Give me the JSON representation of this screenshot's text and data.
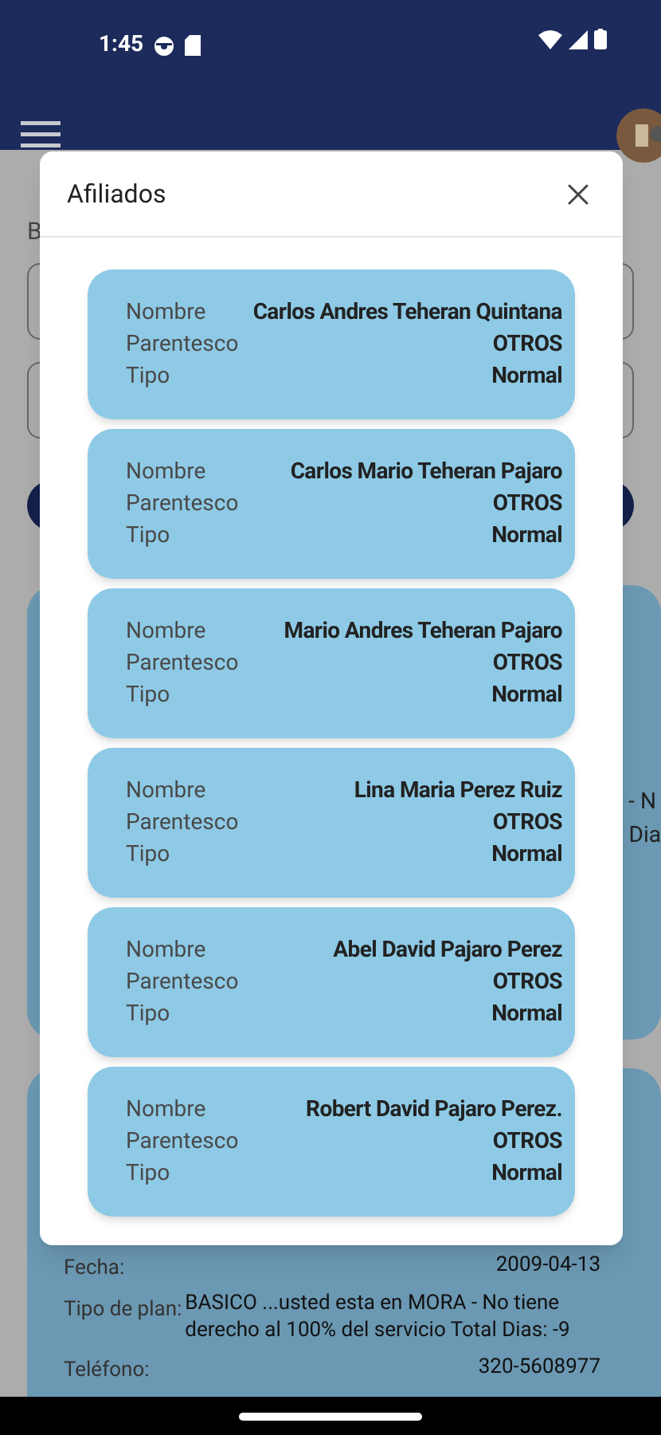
{
  "status_bar": {
    "time": "1:45"
  },
  "background": {
    "heading": "B",
    "card_fragments": [
      "- N",
      "Dia"
    ],
    "contract_rows": [
      {
        "label": "Fecha:",
        "value": "2009-04-13"
      },
      {
        "label": "Tipo de plan:",
        "value": "BASICO ...usted esta en MORA - No tiene derecho al 100% del servicio Total Dias: -9"
      },
      {
        "label": "Teléfono:",
        "value": "320-5608977"
      }
    ]
  },
  "modal": {
    "title": "Afiliados",
    "affiliates": [
      {
        "rows": [
          {
            "label": "Nombre",
            "value": "Carlos Andres Teheran Quintana"
          },
          {
            "label": "Parentesco",
            "value": "OTROS"
          },
          {
            "label": "Tipo",
            "value": "Normal"
          }
        ]
      },
      {
        "rows": [
          {
            "label": "Nombre",
            "value": "Carlos Mario Teheran Pajaro"
          },
          {
            "label": "Parentesco",
            "value": "OTROS"
          },
          {
            "label": "Tipo",
            "value": "Normal"
          }
        ]
      },
      {
        "rows": [
          {
            "label": "Nombre",
            "value": "Mario Andres Teheran Pajaro"
          },
          {
            "label": "Parentesco",
            "value": "OTROS"
          },
          {
            "label": "Tipo",
            "value": "Normal"
          }
        ]
      },
      {
        "rows": [
          {
            "label": "Nombre",
            "value": "Lina Maria Perez Ruiz"
          },
          {
            "label": "Parentesco",
            "value": "OTROS"
          },
          {
            "label": "Tipo",
            "value": "Normal"
          }
        ]
      },
      {
        "rows": [
          {
            "label": "Nombre",
            "value": "Abel David Pajaro Perez"
          },
          {
            "label": "Parentesco",
            "value": "OTROS"
          },
          {
            "label": "Tipo",
            "value": "Normal"
          }
        ]
      },
      {
        "rows": [
          {
            "label": "Nombre",
            "value": "Robert David Pajaro Perez."
          },
          {
            "label": "Parentesco",
            "value": "OTROS"
          },
          {
            "label": "Tipo",
            "value": "Normal"
          }
        ]
      }
    ]
  }
}
